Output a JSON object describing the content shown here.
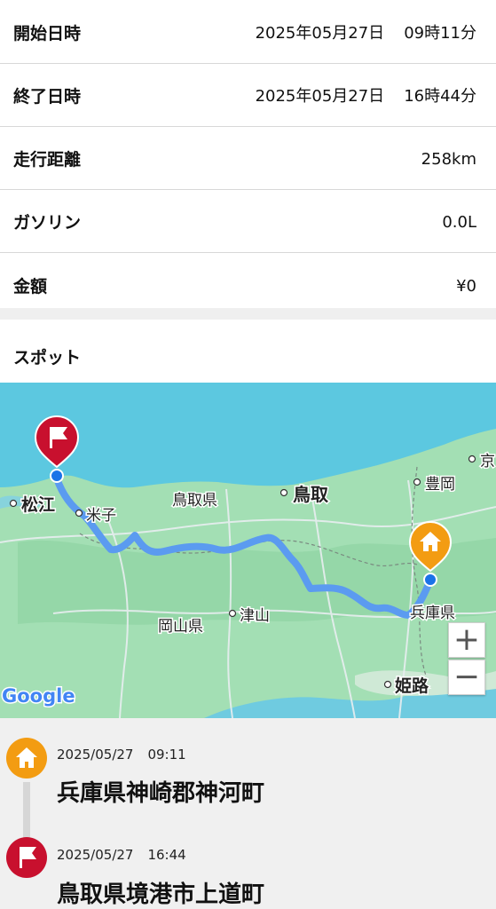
{
  "summary": {
    "start": {
      "label": "開始日時",
      "date": "2025年05月27日",
      "time": "09時11分"
    },
    "end": {
      "label": "終了日時",
      "date": "2025年05月27日",
      "time": "16時44分"
    },
    "distance": {
      "label": "走行距離",
      "value": "258km"
    },
    "gasoline": {
      "label": "ガソリン",
      "value": "0.0L"
    },
    "amount": {
      "label": "金額",
      "value": "¥0"
    }
  },
  "spot": {
    "title": "スポット"
  },
  "map": {
    "labels": {
      "matsue": "松江",
      "yonago": "米子",
      "tottori_pref": "鳥取県",
      "tottori": "鳥取",
      "toyooka": "豊岡",
      "kyo": "京",
      "okayama_pref": "岡山県",
      "tsuyama": "津山",
      "hyogo_pref": "兵庫県",
      "himeji": "姫路"
    },
    "attribution": "Google",
    "zoom_in": "+",
    "zoom_out": "−",
    "colors": {
      "sea": "#5cc8e0",
      "land": "#9ddcb0",
      "route": "#5b9bf0",
      "start": "#f39c12",
      "goal": "#c8102e"
    }
  },
  "timeline": [
    {
      "date": "2025/05/27",
      "time": "09:11",
      "place": "兵庫県神崎郡神河町",
      "icon": "home-icon"
    },
    {
      "date": "2025/05/27",
      "time": "16:44",
      "place": "鳥取県境港市上道町",
      "icon": "flag-icon"
    }
  ]
}
